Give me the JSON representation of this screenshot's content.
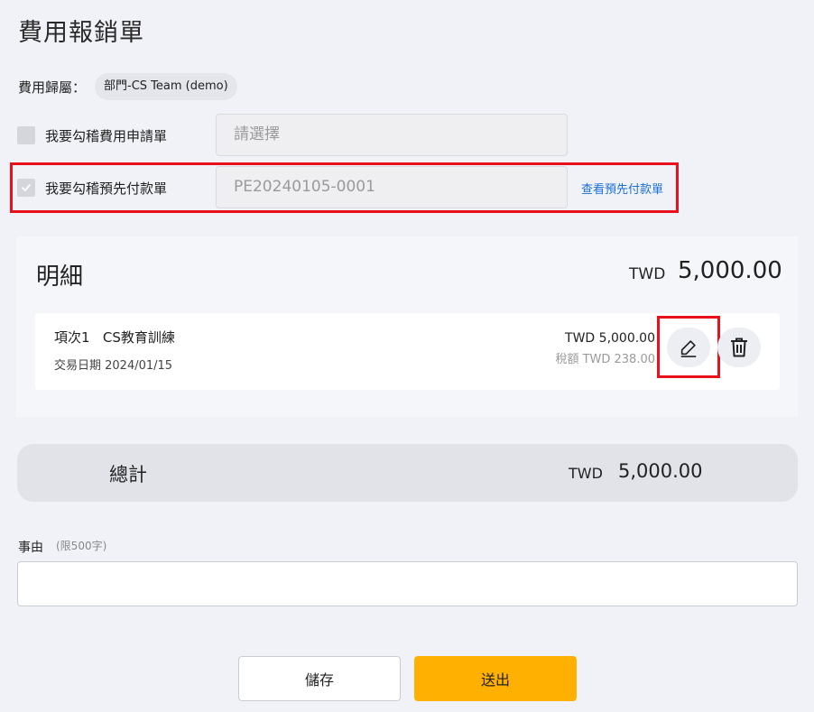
{
  "page": {
    "title": "費用報銷單"
  },
  "belong": {
    "label": "費用歸屬：",
    "value": "部門-CS Team (demo)"
  },
  "reconcile_application": {
    "label": "我要勾稽費用申請單",
    "placeholder": "請選擇",
    "checked": false
  },
  "reconcile_prepayment": {
    "label": "我要勾稽預先付款單",
    "value": "PE20240105-0001",
    "checked": true,
    "link": "查看預先付款單"
  },
  "detail": {
    "title": "明細",
    "currency": "TWD",
    "total": "5,000.00",
    "items": [
      {
        "name": "項次1   CS教育訓練",
        "date": "交易日期 2024/01/15",
        "amount": "TWD 5,000.00",
        "tax": "稅額 TWD 238.00"
      }
    ]
  },
  "summary": {
    "label": "總計",
    "currency": "TWD",
    "amount": "5,000.00"
  },
  "reason": {
    "label": "事由",
    "hint": "(限500字)",
    "value": ""
  },
  "actions": {
    "save_label": "儲存",
    "submit_label": "送出"
  },
  "colors": {
    "accent": "#ffb000",
    "link": "#1a6fd6",
    "highlight": "#e8101b"
  },
  "icons": {
    "checkbox_check": "check-icon",
    "edit": "pencil-icon",
    "delete": "trash-icon"
  }
}
